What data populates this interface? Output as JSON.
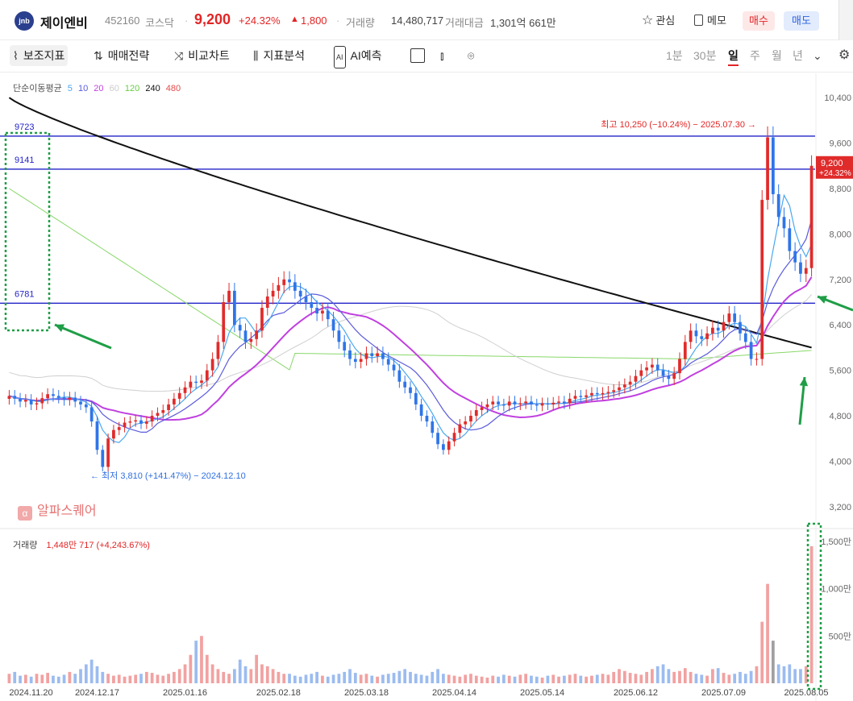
{
  "header": {
    "logo_text": "jnb",
    "name": "제이엔비",
    "code": "452160",
    "market": "코스닥",
    "price": "9,200",
    "change_pct": "+24.32%",
    "change_amt": "1,800",
    "volume_label": "거래량",
    "volume_value": "14,480,717",
    "amount_label": "거래대금",
    "amount_value": "1,301억 661만",
    "watch_label": "관심",
    "memo_label": "메모",
    "buy_label": "매수",
    "sell_label": "매도"
  },
  "toolbar": {
    "indicator_label": "보조지표",
    "strategy_label": "매매전략",
    "compare_label": "비교차트",
    "analysis_label": "지표분석",
    "ai_label": "AI예측",
    "timeframes": [
      "1분",
      "30분",
      "일",
      "주",
      "월",
      "년"
    ],
    "active_timeframe": "일"
  },
  "chart_data": {
    "type": "candlestick",
    "ma_legend": {
      "label": "단순이동평균",
      "periods": [
        {
          "period": "5",
          "color": "#4aa8f0"
        },
        {
          "period": "10",
          "color": "#5b5bdc"
        },
        {
          "period": "20",
          "color": "#c040e0"
        },
        {
          "period": "60",
          "color": "#cccccc"
        },
        {
          "period": "120",
          "color": "#66cc44"
        },
        {
          "period": "240",
          "color": "#111111"
        },
        {
          "period": "480",
          "color": "#e24b4b"
        }
      ]
    },
    "y_axis": {
      "ticks": [
        "10,400",
        "9,600",
        "8,800",
        "8,000",
        "7,200",
        "6,400",
        "5,600",
        "4,800",
        "4,000",
        "3,200"
      ],
      "range": [
        2900,
        10700
      ]
    },
    "x_axis": {
      "ticks": [
        "2024.11.20",
        "2024.12.17",
        "2025.01.16",
        "2025.02.18",
        "2025.03.18",
        "2025.04.14",
        "2025.05.14",
        "2025.06.12",
        "2025.07.09",
        "2025.08.05"
      ]
    },
    "levels": [
      {
        "label": "9723",
        "value": 9723
      },
      {
        "label": "9141",
        "value": 9141
      },
      {
        "label": "6781",
        "value": 6781
      }
    ],
    "annotations": {
      "high": "최고 10,250 (−10.24%) − 2025.07.30",
      "low": "최저 3,810 (+141.47%) − 2024.12.10"
    },
    "last_price_label": {
      "price": "9,200",
      "change": "+24.32%"
    },
    "volume_legend": {
      "label": "거래량",
      "value": "1,448만 717 (+4,243.67%)"
    },
    "volume_axis": {
      "ticks": [
        "1,500만",
        "1,000만",
        "500만"
      ],
      "max": 16000000
    },
    "closes": [
      5150,
      5100,
      5050,
      5080,
      5000,
      5020,
      5110,
      5180,
      5150,
      5120,
      5080,
      5120,
      5050,
      5000,
      4950,
      4700,
      4200,
      3900,
      4400,
      4550,
      4600,
      4680,
      4700,
      4720,
      4660,
      4700,
      4800,
      4850,
      4900,
      5000,
      5100,
      5200,
      5300,
      5400,
      5380,
      5420,
      5600,
      5800,
      6100,
      6800,
      7000,
      6400,
      6300,
      6100,
      6150,
      6300,
      6700,
      6900,
      7000,
      7100,
      7200,
      7150,
      7000,
      6900,
      6800,
      6700,
      6600,
      6650,
      6500,
      6300,
      6100,
      5950,
      5800,
      5750,
      5800,
      5900,
      5850,
      5900,
      5800,
      5700,
      5600,
      5400,
      5300,
      5200,
      5000,
      4800,
      4700,
      4500,
      4300,
      4200,
      4350,
      4500,
      4650,
      4700,
      4800,
      4900,
      4950,
      5000,
      5050,
      5000,
      4980,
      5050,
      5000,
      5020,
      5050,
      5000,
      4980,
      5020,
      5000,
      5030,
      5050,
      5020,
      5100,
      5150,
      5130,
      5160,
      5200,
      5180,
      5200,
      5220,
      5250,
      5300,
      5350,
      5400,
      5500,
      5600,
      5650,
      5700,
      5600,
      5500,
      5450,
      5550,
      5800,
      6100,
      6300,
      6200,
      6150,
      6250,
      6350,
      6300,
      6450,
      6600,
      6450,
      6250,
      6100,
      5800,
      5800,
      8600,
      9700,
      8700,
      8300,
      8100,
      7700,
      7500,
      7300,
      7400,
      9200
    ],
    "volumes": [
      1.0,
      1.2,
      0.8,
      0.9,
      0.7,
      1.0,
      0.9,
      1.1,
      0.8,
      0.7,
      0.9,
      1.2,
      1.0,
      1.5,
      2.0,
      2.5,
      1.8,
      1.2,
      1.0,
      0.8,
      0.9,
      0.7,
      0.8,
      0.9,
      1.0,
      1.2,
      1.1,
      0.9,
      0.8,
      1.0,
      1.2,
      1.5,
      2.0,
      3.0,
      4.5,
      5.0,
      3.0,
      2.0,
      1.5,
      1.2,
      1.0,
      1.5,
      2.5,
      1.8,
      1.5,
      3.0,
      2.0,
      1.8,
      1.5,
      1.2,
      1.0,
      1.0,
      0.8,
      0.7,
      0.9,
      1.0,
      1.2,
      0.8,
      0.7,
      0.9,
      1.0,
      1.2,
      1.5,
      1.1,
      0.9,
      1.0,
      0.8,
      0.7,
      0.9,
      1.0,
      1.1,
      1.3,
      1.5,
      1.2,
      1.0,
      0.9,
      0.8,
      1.2,
      1.5,
      1.0,
      0.9,
      0.8,
      0.7,
      0.9,
      1.0,
      0.8,
      0.7,
      0.6,
      0.8,
      0.7,
      0.9,
      0.8,
      0.7,
      0.9,
      1.0,
      0.8,
      0.7,
      0.6,
      0.8,
      0.9,
      0.7,
      0.8,
      0.9,
      1.0,
      0.8,
      0.7,
      0.8,
      0.9,
      1.0,
      0.9,
      1.2,
      1.5,
      1.3,
      1.1,
      1.0,
      0.9,
      1.2,
      1.5,
      1.8,
      2.0,
      1.5,
      1.2,
      1.3,
      1.6,
      1.2,
      1.0,
      0.9,
      0.8,
      1.5,
      1.6,
      1.1,
      0.9,
      1.0,
      1.2,
      1.0,
      1.3,
      1.8,
      6.5,
      10.5,
      4.5,
      2.0,
      1.8,
      2.0,
      1.5,
      1.5,
      1.8,
      14.48
    ]
  }
}
